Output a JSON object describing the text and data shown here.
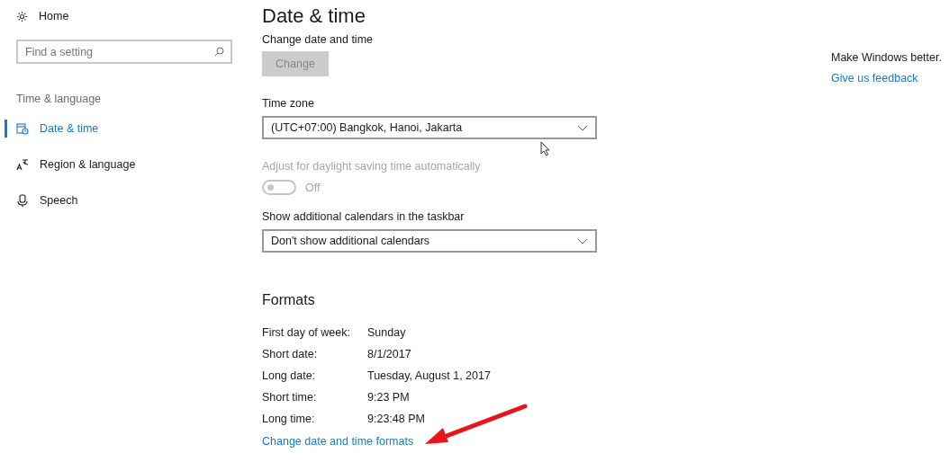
{
  "sidebar": {
    "home": "Home",
    "search": {
      "placeholder": "Find a setting"
    },
    "section": "Time & language",
    "items": [
      {
        "label": "Date & time",
        "kind": "calendar",
        "selected": true
      },
      {
        "label": "Region & language",
        "kind": "region",
        "selected": false
      },
      {
        "label": "Speech",
        "kind": "mic",
        "selected": false
      }
    ]
  },
  "page": {
    "title": "Date & time",
    "change_label": "Change date and time",
    "change_button": {
      "label": "Change",
      "disabled": true
    },
    "timezone": {
      "label": "Time zone",
      "value": "(UTC+07:00) Bangkok, Hanoi, Jakarta"
    },
    "daylight": {
      "label": "Adjust for daylight saving time automatically",
      "disabled": true,
      "toggle": {
        "on": false,
        "text": "Off"
      }
    },
    "calendars": {
      "label": "Show additional calendars in the taskbar",
      "value": "Don't show additional calendars"
    },
    "formats": {
      "title": "Formats",
      "rows": [
        {
          "label": "First day of week:",
          "value": "Sunday"
        },
        {
          "label": "Short date:",
          "value": "8/1/2017"
        },
        {
          "label": "Long date:",
          "value": "Tuesday, August 1, 2017"
        },
        {
          "label": "Short time:",
          "value": "9:23 PM"
        },
        {
          "label": "Long time:",
          "value": "9:23:48 PM"
        }
      ],
      "link": "Change date and time formats"
    }
  },
  "aside": {
    "text": "Make Windows better.",
    "link": "Give us feedback"
  }
}
